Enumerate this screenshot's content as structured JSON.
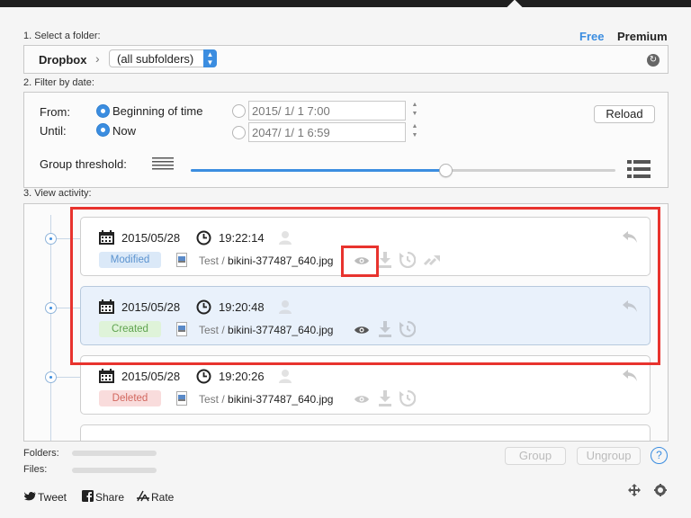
{
  "header": {
    "plan_free": "Free",
    "plan_premium": "Premium"
  },
  "folder_section": {
    "label": "1. Select a folder:",
    "folder_name": "Dropbox",
    "subfolder_select": "(all subfolders)"
  },
  "date_section": {
    "label": "2. Filter by date:",
    "from_label": "From:",
    "until_label": "Until:",
    "from_option": "Beginning of time",
    "until_option": "Now",
    "from_date": "2015/  1/  1   7:00",
    "until_date": "2047/  1/  1   6:59",
    "reload_label": "Reload",
    "group_threshold_label": "Group threshold:",
    "group_threshold_value": 0.6
  },
  "activity_section": {
    "label": "3. View activity:",
    "entries": [
      {
        "date": "2015/05/28",
        "time": "19:22:14",
        "status": "Modified",
        "folder": "Test",
        "separator": " / ",
        "file": "bikini-377487_640.jpg"
      },
      {
        "date": "2015/05/28",
        "time": "19:20:48",
        "status": "Created",
        "folder": "Test",
        "separator": " / ",
        "file": "bikini-377487_640.jpg"
      },
      {
        "date": "2015/05/28",
        "time": "19:20:26",
        "status": "Deleted",
        "folder": "Test",
        "separator": " / ",
        "file": "bikini-377487_640.jpg"
      }
    ]
  },
  "footer": {
    "folders_label": "Folders:",
    "files_label": "Files:",
    "group_label": "Group",
    "ungroup_label": "Ungroup",
    "help_label": "?",
    "tweet_label": "Tweet",
    "share_label": "Share",
    "rate_label": "Rate"
  },
  "colors": {
    "accent": "#3b8de0",
    "modified_badge": "#dbe9f8",
    "created_badge": "#dff3d9",
    "deleted_badge": "#f9dcdc",
    "highlight": "#e8332e"
  }
}
